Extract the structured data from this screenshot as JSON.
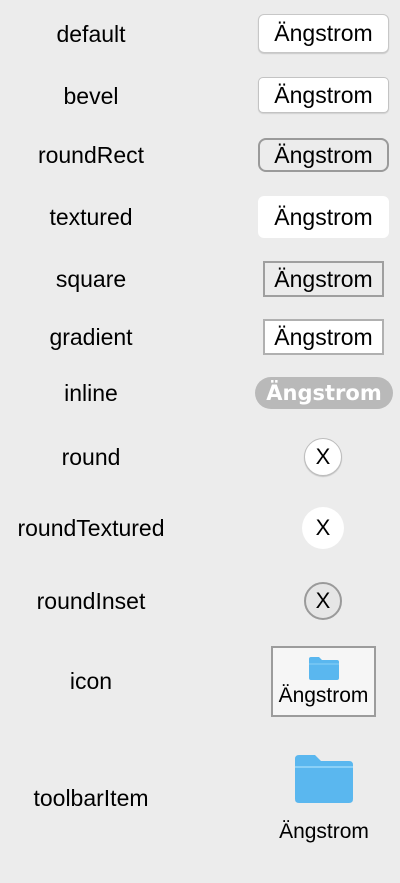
{
  "rows": [
    {
      "label": "default",
      "title": "Ängstrom"
    },
    {
      "label": "bevel",
      "title": "Ängstrom"
    },
    {
      "label": "roundRect",
      "title": "Ängstrom"
    },
    {
      "label": "textured",
      "title": "Ängstrom"
    },
    {
      "label": "square",
      "title": "Ängstrom"
    },
    {
      "label": "gradient",
      "title": "Ängstrom"
    },
    {
      "label": "inline",
      "title": "Ängstrom"
    },
    {
      "label": "round",
      "title": "X"
    },
    {
      "label": "roundTextured",
      "title": "X"
    },
    {
      "label": "roundInset",
      "title": "X"
    },
    {
      "label": "icon",
      "title": "Ängstrom",
      "icon": "folder-icon"
    },
    {
      "label": "toolbarItem",
      "title": "Ängstrom",
      "icon": "folder-icon"
    }
  ],
  "colors": {
    "background": "#ececec",
    "folder": "#5ab7ef",
    "inline_fill": "#b9b9b9"
  }
}
